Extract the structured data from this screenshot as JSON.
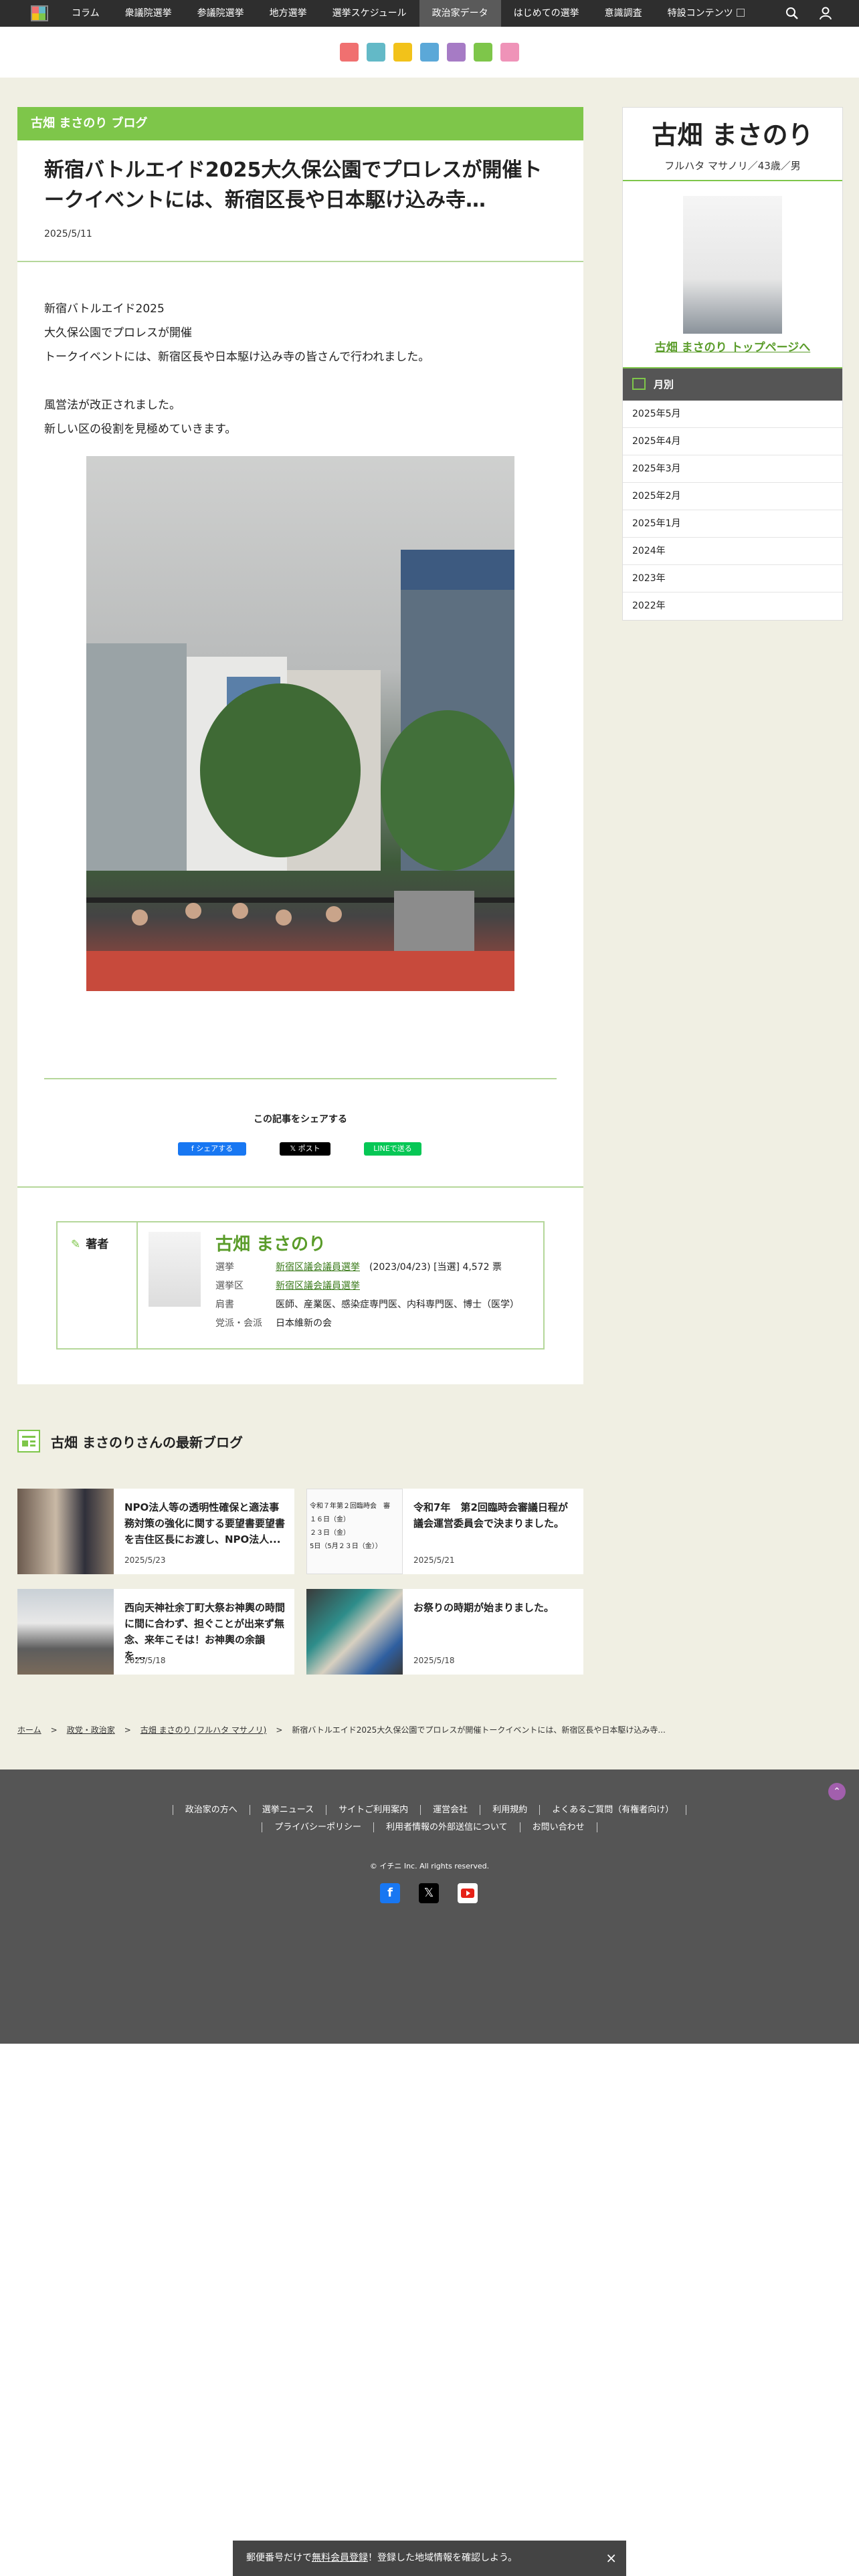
{
  "nav": {
    "items": [
      "コラム",
      "衆議院選挙",
      "参議院選挙",
      "地方選挙",
      "選挙スケジュール",
      "政治家データ",
      "はじめての選挙",
      "意識調査",
      "特設コンテンツ"
    ],
    "active_index": 5
  },
  "subbar_colors": [
    "#f07070",
    "#63b9c7",
    "#f2c21a",
    "#5ba8d8",
    "#a67bc5",
    "#7ec64a",
    "#ef93b8"
  ],
  "blog": {
    "header": "古畑 まさのり ブログ",
    "title": "新宿バトルエイド2025大久保公園でプロレスが開催トークイベントには、新宿区長や日本駆け込み寺…",
    "date": "2025/5/11",
    "body": [
      "新宿バトルエイド2025",
      "大久保公園でプロレスが開催",
      "トークイベントには、新宿区長や日本駆け込み寺の皆さんで行われました。",
      "",
      "風営法が改正されました。",
      "新しい区の役割を見極めていきます。"
    ]
  },
  "share": {
    "title": "この記事をシェアする",
    "facebook": "シェアする",
    "x": "ポスト",
    "line": "LINEで送る"
  },
  "author": {
    "label": "著者",
    "name": "古畑 まさのり",
    "rows": [
      {
        "key": "選挙",
        "link": "新宿区議会議員選挙",
        "extra": "(2023/04/23) [当選] 4,572 票"
      },
      {
        "key": "選挙区",
        "link": "新宿区議会議員選挙",
        "extra": ""
      },
      {
        "key": "肩書",
        "link": "",
        "extra": "医師、産業医、感染症専門医、内科専門医、博士（医学）"
      },
      {
        "key": "党派・会派",
        "link": "",
        "extra": "日本維新の会"
      }
    ]
  },
  "latest": {
    "title": "古畑 まさのりさんの最新ブログ",
    "cards": [
      {
        "title": "NPO法人等の透明性確保と適法事務対策の強化に関する要望書要望書を吉住区長にお渡し、NPO法人...",
        "date": "2025/5/23"
      },
      {
        "title": "令和7年　第2回臨時会審議日程が議会運営委員会で決まりました。",
        "date": "2025/5/21",
        "thumb_lines": [
          "令和７年第２回臨時会　審",
          "１６日（金）",
          "２３日（金）",
          "5日（5月２３日（金））"
        ]
      },
      {
        "title": "西向天神社余丁町大祭お神輿の時間に間に合わず、担ぐことが出来ず無念、来年こそは！お神輿の余韻を...",
        "date": "2025/5/18"
      },
      {
        "title": "お祭りの時期が始まりました。",
        "date": "2025/5/18"
      }
    ]
  },
  "breadcrumb": [
    "ホーム",
    "政党・政治家",
    "古畑 まさのり (フルハタ マサノリ)",
    "新宿バトルエイド2025大久保公園でプロレスが開催トークイベントには、新宿区長や日本駆け込み寺..."
  ],
  "sidebar": {
    "name": "古畑 まさのり",
    "sub": "フルハタ マサノリ／43歳／男",
    "top_link": "古畑 まさのり トップページへ",
    "monthly_title": "月別",
    "months": [
      "2025年5月",
      "2025年4月",
      "2025年3月",
      "2025年2月",
      "2025年1月",
      "2024年",
      "2023年",
      "2022年"
    ]
  },
  "footer": {
    "links_row1": [
      "政治家の方へ",
      "選挙ニュース",
      "サイトご利用案内",
      "運営会社",
      "利用規約",
      "よくあるご質問（有権者向け）"
    ],
    "links_row2": [
      "プライバシーポリシー",
      "利用者情報の外部送信について",
      "お問い合わせ"
    ],
    "copyright": "© イチニ Inc. All rights reserved."
  },
  "banner": {
    "prefix": "郵便番号だけで",
    "link": "無料会員登録",
    "suffix": "！登録した地域情報を確認しよう。",
    "close": "×"
  }
}
